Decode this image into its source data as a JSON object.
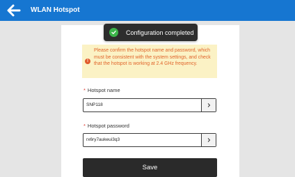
{
  "header": {
    "title": "WLAN Hotspot"
  },
  "toast": {
    "text": "Configuration completed"
  },
  "warning": {
    "text": "Please confirm the hotspot name and password, which must be consistent with the system settings, and check that the hotspot is working at 2.4 GHz frequency."
  },
  "fields": {
    "required_mark": "*",
    "name_label": "Hotspot name",
    "name_value": "SNP118",
    "password_label": "Hotspot password",
    "password_value": "rx6ry7aukeui3q3"
  },
  "actions": {
    "save_label": "Save"
  },
  "colors": {
    "header_bg": "#1676d1",
    "toast_bg": "#2d2d2d",
    "success": "#3cb54a",
    "warning_bg": "#fbf2c5",
    "warning_text": "#e0642a",
    "save_bg": "#2a2a2a"
  },
  "icons": {
    "back": "arrow-left-icon",
    "toast": "check-circle-icon",
    "warning": "exclamation-circle-icon",
    "chevron": "chevron-right-icon"
  }
}
